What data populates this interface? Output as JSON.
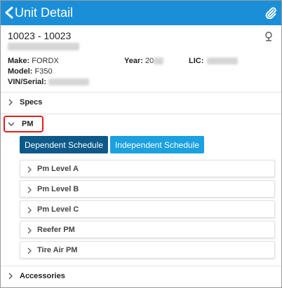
{
  "header": {
    "title": "Unit Detail",
    "back_icon": "chevron-left-icon",
    "attach_icon": "paperclip-icon",
    "color": "#1a8fd8"
  },
  "unit": {
    "id": "10023 - 10023",
    "pin_icon": "pin-icon",
    "make_label": "Make:",
    "make_value": "FORDX",
    "year_label": "Year:",
    "year_value": "20",
    "lic_label": "LIC:",
    "model_label": "Model:",
    "model_value": "F350",
    "vin_label": "VIN/Serial:"
  },
  "sections": {
    "specs": "Specs",
    "pm": "PM",
    "accessories": "Accessories"
  },
  "pm": {
    "dependent_label": "Dependent Schedule",
    "independent_label": "Independent Schedule",
    "dependent_color": "#0d5a8a",
    "independent_color": "#1ba0e0",
    "items": [
      {
        "label": "Pm Level A"
      },
      {
        "label": "Pm Level B"
      },
      {
        "label": "Pm Level C"
      },
      {
        "label": "Reefer PM"
      },
      {
        "label": "Tire Air PM"
      }
    ]
  },
  "highlight_color": "#e11d1d"
}
